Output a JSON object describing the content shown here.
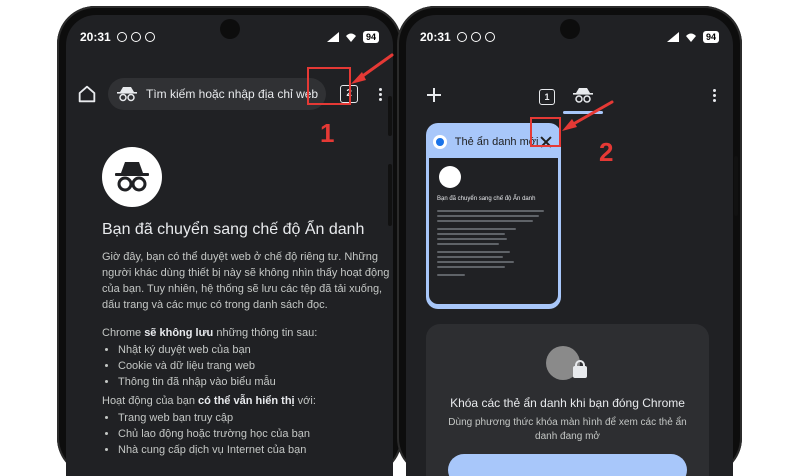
{
  "colors": {
    "annotation": "#e53935",
    "screen_bg": "#202124",
    "accent": "#a8c7fa"
  },
  "left_phone": {
    "status": {
      "time": "20:31",
      "battery": "94"
    },
    "toolbar": {
      "home_icon": "home-icon",
      "search_placeholder": "Tìm kiếm hoặc nhập địa chỉ web",
      "tab_count": "2",
      "menu_icon": "more-vert-icon"
    },
    "content": {
      "headline": "Bạn đã chuyển sang chế độ Ẩn danh",
      "paragraph1": "Giờ đây, bạn có thể duyệt web ở chế độ riêng tư. Những người khác dùng thiết bị này sẽ không nhìn thấy hoạt động của bạn. Tuy nhiên, hệ thống sẽ lưu các tệp đã tải xuống, dấu trang và các mục có trong danh sách đọc.",
      "not_saved_prefix": "Chrome ",
      "not_saved_bold": "sẽ không lưu",
      "not_saved_suffix": " những thông tin sau:",
      "not_saved_items": [
        "Nhật ký duyệt web của bạn",
        "Cookie và dữ liệu trang web",
        "Thông tin đã nhập vào biểu mẫu"
      ],
      "visible_prefix": "Hoạt động của bạn ",
      "visible_bold": "có thể vẫn hiển thị",
      "visible_suffix": " với:",
      "visible_items": [
        "Trang web bạn truy cập",
        "Chủ lao động hoặc trường học của bạn",
        "Nhà cung cấp dịch vụ Internet của bạn"
      ]
    },
    "annotation_number": "1"
  },
  "right_phone": {
    "status": {
      "time": "20:31",
      "battery": "94"
    },
    "toolbar": {
      "new_tab_icon": "plus-icon",
      "tab_count": "1",
      "incognito_icon": "incognito-icon",
      "menu_icon": "more-vert-icon"
    },
    "tab_card": {
      "title": "Thẻ ẩn danh mới",
      "close_icon": "close-icon",
      "preview_headline": "Bạn đã chuyển sang chế độ Ẩn danh"
    },
    "lock_card": {
      "title": "Khóa các thẻ ẩn danh khi bạn đóng Chrome",
      "description": "Dùng phương thức khóa màn hình để xem các thẻ ẩn danh đang mở"
    },
    "annotation_number": "2"
  }
}
